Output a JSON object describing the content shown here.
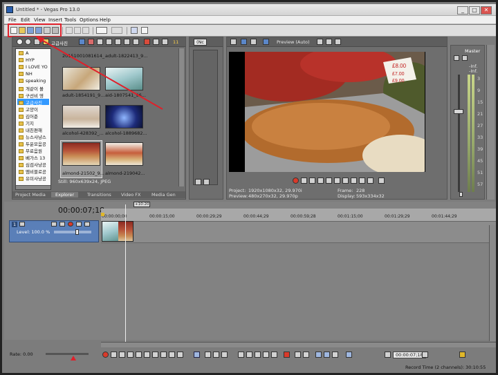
{
  "window": {
    "title": "Untitled * - Vegas Pro 13.0",
    "min": "_",
    "max": "□",
    "close": "✕"
  },
  "menu": [
    "File",
    "Edit",
    "View",
    "Insert",
    "Tools",
    "Options",
    "Help"
  ],
  "explorer": {
    "path_label": "고급사진",
    "view_count": "11",
    "tree": [
      "A",
      "HYP",
      "I LOVE YO",
      "NH",
      "speaking",
      "개같이 볼",
      "구선비 영",
      "고급사진",
      "고양이",
      "김어준",
      "기지",
      "내친편해",
      "뉴스사냥스",
      "두운모음공",
      "무료음원",
      "베가스 13",
      "심검사냥공",
      "엠비블로공",
      "유미사냥공"
    ],
    "selected": "고급사진",
    "thumbs": [
      {
        "label": "20151001081614_"
      },
      {
        "label": "adult-1822413_9..."
      },
      {
        "label": "adult-1854191_9..."
      },
      {
        "label": "aid-1807541_96..."
      },
      {
        "label": "alcohol-428392_..."
      },
      {
        "label": "alcohol-1889682..."
      },
      {
        "label": "almond-21502_9..."
      },
      {
        "label": "almond-219042..."
      }
    ],
    "status": "Still: 960x639x24, JPEG",
    "tabs": [
      "Project Media",
      "Explorer",
      "Transitions",
      "Video FX",
      "Media Gen"
    ],
    "active_tab": "Explorer"
  },
  "trimmer": {
    "dropdown": "(Nc"
  },
  "preview": {
    "quality": "Preview (Auto)",
    "project_label": "Project:",
    "project_value": "1920x1080x32, 29.970i",
    "preview_label": "Preview:",
    "preview_value": "480x270x32, 29.970p",
    "frame_label": "Frame:",
    "frame_value": "228",
    "display_label": "Display:",
    "display_value": "593x334x32",
    "signs": [
      "£8.00",
      "£7.00",
      "£9.00"
    ]
  },
  "master": {
    "title": "Master",
    "peaks": [
      "-Inf.",
      "-Inf."
    ],
    "scale": [
      "3",
      "9",
      "15",
      "21",
      "27",
      "33",
      "39",
      "45",
      "51",
      "57"
    ]
  },
  "timeline": {
    "timecode": "00:00:07;18",
    "cursor_badge": "+10:20",
    "ruler": [
      "00:00:00;00",
      "00:00:15;00",
      "00:00:29;29",
      "00:00:44;29",
      "00:00:59;28",
      "00:01:15;00",
      "00:01:29;29",
      "00:01:44;29"
    ],
    "track_number": "1",
    "level": "Level: 100.0 %"
  },
  "bottom": {
    "rate": "Rate: 0.00",
    "time_field": "00:00:07;18",
    "record_time": "Record Time (2 channels): 30:10:55"
  }
}
